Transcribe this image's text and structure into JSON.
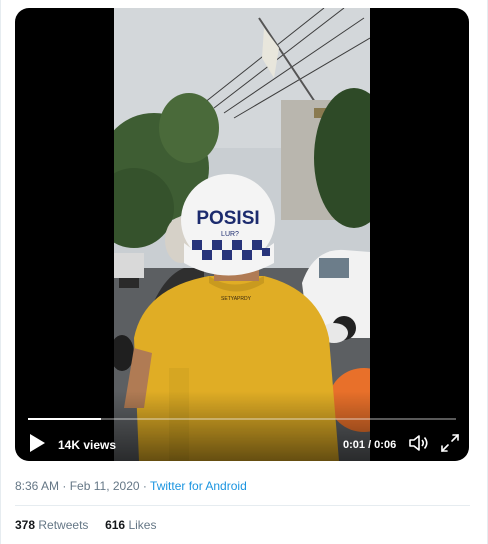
{
  "video": {
    "helmet_text": "POSISI",
    "helmet_subtext": "LUR?",
    "shirt_text": "SETYAPRDY",
    "views_label": "14K views",
    "time_label": "0:01 / 0:06",
    "progress_fraction": 0.17
  },
  "tweet": {
    "time": "8:36 AM",
    "separator": "·",
    "date": "Feb 11, 2020",
    "source": "Twitter for Android",
    "retweets_count": "378",
    "retweets_label": "Retweets",
    "likes_count": "616",
    "likes_label": "Likes"
  },
  "colors": {
    "link": "#1b95e0",
    "muted": "#657786",
    "divider": "#e6ecf0"
  },
  "icons": {
    "play": "play-icon",
    "volume": "volume-icon",
    "fullscreen": "fullscreen-icon"
  }
}
